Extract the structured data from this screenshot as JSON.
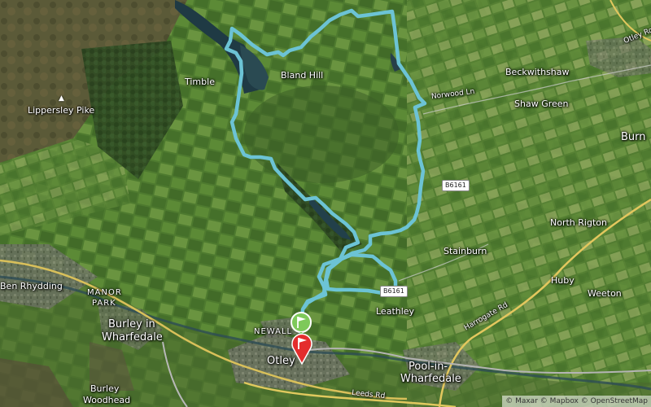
{
  "places": {
    "timble": "Timble",
    "bland_hill": "Bland Hill",
    "lippersley_pike": "Lippersley Pike",
    "beckwithshaw": "Beckwithshaw",
    "shaw_green": "Shaw Green",
    "burn": "Burn",
    "otley_ro": "Otley Ro",
    "north_rigton": "North Rigton",
    "stainburn": "Stainburn",
    "huby": "Huby",
    "weeton": "Weeton",
    "leathley": "Leathley",
    "ben_rhydding": "Ben Rhydding",
    "manor": "MANOR",
    "park": "PARK",
    "burley_in": "Burley in",
    "wharfedale": "Wharfedale",
    "newall": "NEWALL",
    "otley": "Otley",
    "pool_in": "Pool-in-",
    "pool_wharfedale": "Wharfedale",
    "burley_woodhead_1": "Burley",
    "burley_woodhead_2": "Woodhead"
  },
  "roads": {
    "norwood_ln": "Norwood Ln",
    "harrogate_rd": "Harrogate Rd",
    "leeds_rd": "Leeds Rd",
    "b6161_a": "B6161",
    "b6161_b": "B6161"
  },
  "route": {
    "color": "#6cc3d5",
    "start_flag": "green",
    "end_flag": "red"
  },
  "attribution": "© Maxar © Mapbox © OpenStreetMap"
}
